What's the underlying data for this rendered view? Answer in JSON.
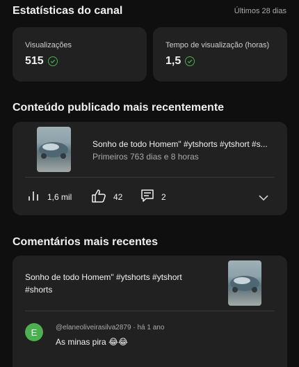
{
  "channel_stats": {
    "title": "Estatísticas do canal",
    "period": "Últimos 28 dias",
    "views": {
      "label": "Visualizações",
      "value": "515"
    },
    "watch_time": {
      "label": "Tempo de visualização (horas)",
      "value": "1,5"
    }
  },
  "recent_content": {
    "title": "Conteúdo publicado mais recentemente",
    "video_title": "Sonho de todo Homem\" #ytshorts #ytshort #s...",
    "video_meta": "Primeiros 763 dias e 8 horas",
    "views": "1,6 mil",
    "likes": "42",
    "comments": "2"
  },
  "recent_comments": {
    "title": "Comentários mais recentes",
    "video_title": "Sonho de todo Homem\" #ytshorts #ytshort #shorts",
    "comment": {
      "avatar_letter": "E",
      "author": "@elaneoliveirasilva2879",
      "time": "há 1 ano",
      "text": "As minas pira 😂😂"
    }
  },
  "colors": {
    "background": "#0f0f0f",
    "card": "#212121",
    "accent_green": "#4caf50"
  },
  "icons": [
    "check-circle-icon",
    "bar-chart-icon",
    "thumbs-up-icon",
    "comment-icon",
    "chevron-down-icon"
  ]
}
